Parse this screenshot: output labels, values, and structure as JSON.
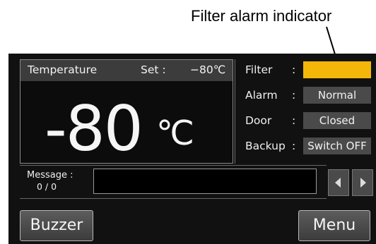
{
  "callout": {
    "text": "Filter alarm indicator"
  },
  "temperature": {
    "label": "Temperature",
    "set_label": "Set :",
    "set_value": "−80℃",
    "value": "-80",
    "unit": "℃"
  },
  "status": [
    {
      "label": "Filter",
      "colon": ":",
      "value": "",
      "state": "alarm"
    },
    {
      "label": "Alarm",
      "colon": ":",
      "value": "Normal",
      "state": "normal"
    },
    {
      "label": "Door",
      "colon": ":",
      "value": "Closed",
      "state": "normal"
    },
    {
      "label": "Backup",
      "colon": ":",
      "value": "Switch OFF",
      "state": "normal"
    }
  ],
  "message": {
    "label": "Message :",
    "count": "0 / 0",
    "text": ""
  },
  "nav": {
    "prev_icon": "triangle-left-icon",
    "next_icon": "triangle-right-icon"
  },
  "buttons": {
    "buzzer": "Buzzer",
    "menu": "Menu"
  },
  "colors": {
    "alarm": "#f5b60a",
    "panel": "#111111",
    "cell": "#4a4a4a"
  }
}
